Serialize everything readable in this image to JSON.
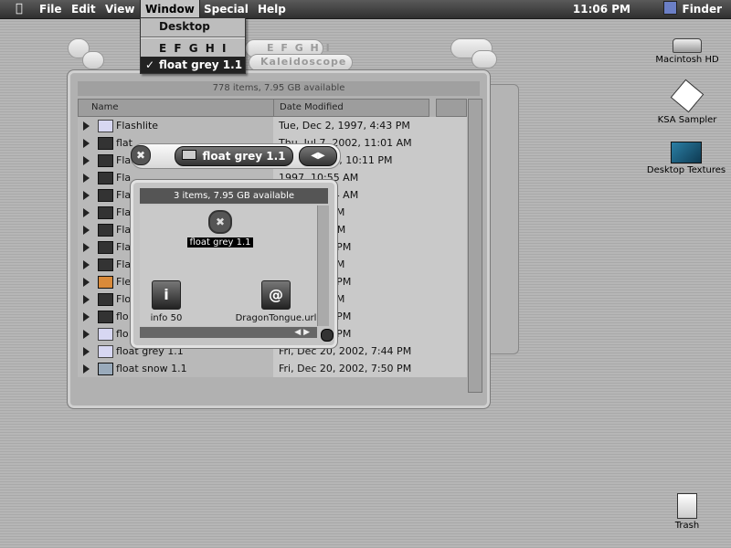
{
  "menubar": {
    "apple": "",
    "items": [
      "File",
      "Edit",
      "View",
      "Window",
      "Special",
      "Help"
    ],
    "clock": "11:06 PM",
    "app_name": "Finder"
  },
  "window_menu": {
    "items": [
      "Desktop",
      "E F G H I",
      "float grey 1.1"
    ],
    "checked": "✓"
  },
  "background_tabs": {
    "tab1": "E F G H I",
    "tab2": "Kaleidoscope"
  },
  "main_window": {
    "status": "778 items, 7.95 GB available",
    "columns": {
      "name": "Name",
      "date": "Date Modified"
    },
    "rows": [
      {
        "name": "Flashlite",
        "date": "Tue, Dec 2, 1997, 4:43 PM"
      },
      {
        "name": "flat",
        "date": "Thu, Jul 7, 2002, 11:01 AM"
      },
      {
        "name": "Flat Minim",
        "date": "Mar 1, 1999, 10:11 PM"
      },
      {
        "name": "Fla",
        "date": "1997, 10:55 AM"
      },
      {
        "name": "Fla",
        "date": "1997, 11:24 AM"
      },
      {
        "name": "Fla",
        "date": "997, 1:35 PM"
      },
      {
        "name": "Fla",
        "date": "998, 8:14 AM"
      },
      {
        "name": "Fla",
        "date": "998, 11:19 PM"
      },
      {
        "name": "Fla",
        "date": "997, 2:09 PM"
      },
      {
        "name": "Fle",
        "date": "2000, 2:01 PM"
      },
      {
        "name": "Flo",
        "date": "998, 8:06 PM"
      },
      {
        "name": "flo",
        "date": "2002, 8:01 PM"
      },
      {
        "name": "flo",
        "date": "2002, 3:19 PM"
      },
      {
        "name": "float grey 1.1",
        "date": "Fri, Dec 20, 2002, 7:44 PM"
      },
      {
        "name": "float snow 1.1",
        "date": "Fri, Dec 20, 2002, 7:50 PM"
      }
    ]
  },
  "float_window": {
    "title": "float grey 1.1",
    "status": "3 items, 7.95 GB available",
    "items": {
      "folder": "float grey 1.1",
      "info": "info 50",
      "url": "DragonTongue.url"
    },
    "info_glyph": "i",
    "url_glyph": "@"
  },
  "desktop_icons": {
    "hd": "Macintosh HD",
    "ksa": "KSA Sampler",
    "textures": "Desktop Textures",
    "trash": "Trash"
  }
}
